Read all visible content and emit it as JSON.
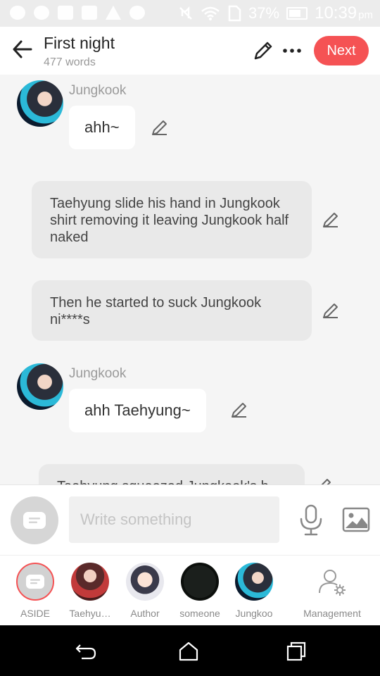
{
  "status_bar": {
    "battery": "37%",
    "time": "10:39",
    "ampm": "pm",
    "icons": [
      "add-icon",
      "whatsapp-icon",
      "keyboard-icon",
      "calendar-icon",
      "warning-icon",
      "cloud-icon",
      "mute-icon",
      "wifi-icon",
      "sim-icon",
      "battery-icon"
    ]
  },
  "header": {
    "title": "First night",
    "word_count": "477 words",
    "next_label": "Next"
  },
  "chat": {
    "messages": [
      {
        "type": "dialogue",
        "speaker": "Jungkook",
        "text": "ahh~"
      },
      {
        "type": "narration",
        "text": "Taehyung slide his hand in Jungkook shirt removing it leaving Jungkook half naked"
      },
      {
        "type": "narration",
        "text": "Then he started to suck Jungkook ni****s"
      },
      {
        "type": "dialogue",
        "speaker": "Jungkook",
        "text": "ahh Taehyung~"
      },
      {
        "type": "narration",
        "text": "Taehyung squeezed Jungkook's b..."
      }
    ]
  },
  "input": {
    "placeholder": "Write something"
  },
  "characters": [
    {
      "label": "ASIDE",
      "selected": true
    },
    {
      "label": "Taehyu…"
    },
    {
      "label": "Author"
    },
    {
      "label": "someone"
    },
    {
      "label": "Jungkoo"
    },
    {
      "label": "Management"
    }
  ],
  "colors": {
    "accent": "#f55254",
    "background": "#f5f5f5",
    "narration_bg": "#e9e9e9"
  }
}
